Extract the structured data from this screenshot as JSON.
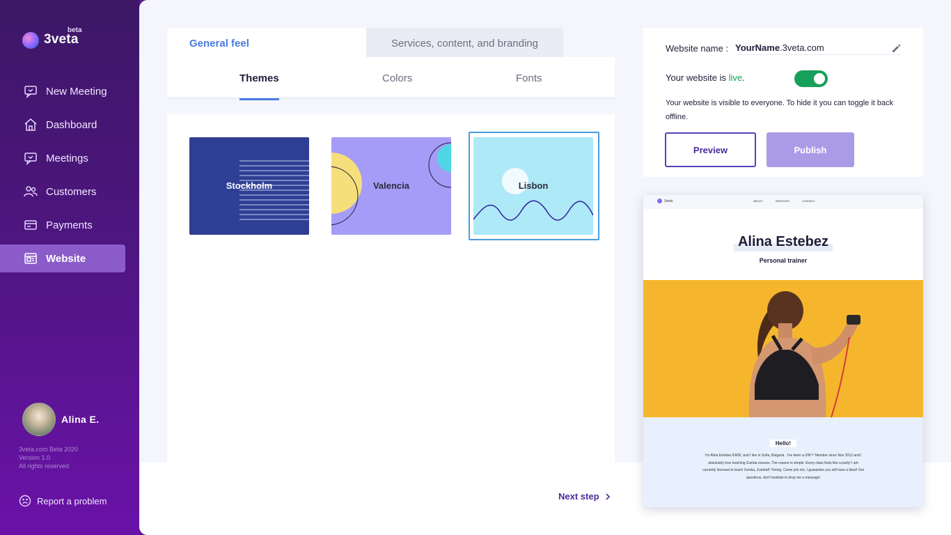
{
  "app": {
    "logo_text": "3veta",
    "beta_label": "beta"
  },
  "sidebar": {
    "items": [
      {
        "label": "New Meeting",
        "icon": "chat-icon"
      },
      {
        "label": "Dashboard",
        "icon": "home-icon"
      },
      {
        "label": "Meetings",
        "icon": "chat-icon"
      },
      {
        "label": "Customers",
        "icon": "people-icon"
      },
      {
        "label": "Payments",
        "icon": "card-icon"
      },
      {
        "label": "Website",
        "icon": "website-icon",
        "active": true
      }
    ],
    "user_name": "Alina E.",
    "footnote_line1": "3veta.com Beta 2020",
    "footnote_line2": "Version 1.0",
    "footnote_line3": "All rights reserved",
    "report_label": "Report a problem"
  },
  "main": {
    "tabs": [
      {
        "label": "General feel",
        "active": true
      },
      {
        "label": "Services, content, and branding",
        "active": false
      }
    ],
    "subtabs": [
      {
        "label": "Themes",
        "active": true
      },
      {
        "label": "Colors",
        "active": false
      },
      {
        "label": "Fonts",
        "active": false
      }
    ],
    "themes": [
      {
        "name": "Stockholm",
        "color": "#2f3f94"
      },
      {
        "name": "Valencia",
        "color": "#a59cf8"
      },
      {
        "name": "Lisbon",
        "color": "#aee9f7",
        "selected": true
      }
    ],
    "next_step_label": "Next step"
  },
  "settings": {
    "website_name_label": "Website name :",
    "website_name_user": "YourName",
    "website_name_domain": ".3veta.com",
    "live_prefix": "Your website is ",
    "live_word": "live",
    "live_suffix": ".",
    "live_enabled": true,
    "live_description": "Your website is visible to everyone. To hide it you can toggle it back offline.",
    "preview_button": "Preview",
    "publish_button": "Publish",
    "accent_color": "#4b2c9e",
    "live_color": "#16a05a"
  },
  "preview": {
    "logo": "3veta",
    "nav_links": [
      "ABOUT",
      "SERVICES",
      "CONTACT"
    ],
    "name": "Alina Estebez",
    "role": "Personal trainer",
    "hello": "Hello!",
    "about_text": "I'm Alina Estebez EMSI, and I live in Sofia, Bulgaria . I've been a ZIN™ Member since Nov 2012 and I absolutely love teaching Zumba classes. The reason is simple: Every class feels like a party! I am currently licensed to teach Zumba, Zumba® Toning. Come join me, I guarantee you will have a blast! Got questions, don't hesitate to drop me a message!",
    "hero_color": "#f5b62d"
  }
}
